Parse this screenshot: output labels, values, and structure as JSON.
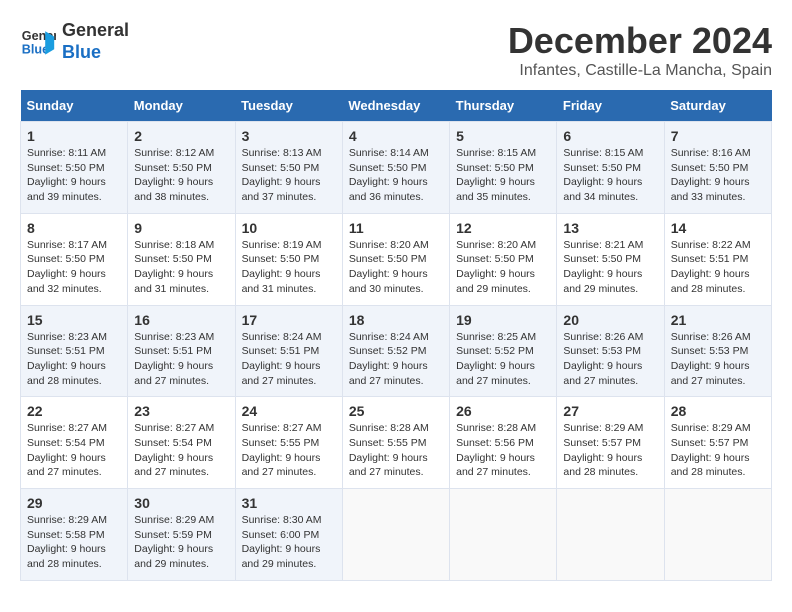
{
  "header": {
    "logo_line1": "General",
    "logo_line2": "Blue",
    "main_title": "December 2024",
    "subtitle": "Infantes, Castille-La Mancha, Spain"
  },
  "calendar": {
    "weekdays": [
      "Sunday",
      "Monday",
      "Tuesday",
      "Wednesday",
      "Thursday",
      "Friday",
      "Saturday"
    ],
    "weeks": [
      [
        {
          "day": "1",
          "info": "Sunrise: 8:11 AM\nSunset: 5:50 PM\nDaylight: 9 hours and 39 minutes."
        },
        {
          "day": "2",
          "info": "Sunrise: 8:12 AM\nSunset: 5:50 PM\nDaylight: 9 hours and 38 minutes."
        },
        {
          "day": "3",
          "info": "Sunrise: 8:13 AM\nSunset: 5:50 PM\nDaylight: 9 hours and 37 minutes."
        },
        {
          "day": "4",
          "info": "Sunrise: 8:14 AM\nSunset: 5:50 PM\nDaylight: 9 hours and 36 minutes."
        },
        {
          "day": "5",
          "info": "Sunrise: 8:15 AM\nSunset: 5:50 PM\nDaylight: 9 hours and 35 minutes."
        },
        {
          "day": "6",
          "info": "Sunrise: 8:15 AM\nSunset: 5:50 PM\nDaylight: 9 hours and 34 minutes."
        },
        {
          "day": "7",
          "info": "Sunrise: 8:16 AM\nSunset: 5:50 PM\nDaylight: 9 hours and 33 minutes."
        }
      ],
      [
        {
          "day": "8",
          "info": "Sunrise: 8:17 AM\nSunset: 5:50 PM\nDaylight: 9 hours and 32 minutes."
        },
        {
          "day": "9",
          "info": "Sunrise: 8:18 AM\nSunset: 5:50 PM\nDaylight: 9 hours and 31 minutes."
        },
        {
          "day": "10",
          "info": "Sunrise: 8:19 AM\nSunset: 5:50 PM\nDaylight: 9 hours and 31 minutes."
        },
        {
          "day": "11",
          "info": "Sunrise: 8:20 AM\nSunset: 5:50 PM\nDaylight: 9 hours and 30 minutes."
        },
        {
          "day": "12",
          "info": "Sunrise: 8:20 AM\nSunset: 5:50 PM\nDaylight: 9 hours and 29 minutes."
        },
        {
          "day": "13",
          "info": "Sunrise: 8:21 AM\nSunset: 5:50 PM\nDaylight: 9 hours and 29 minutes."
        },
        {
          "day": "14",
          "info": "Sunrise: 8:22 AM\nSunset: 5:51 PM\nDaylight: 9 hours and 28 minutes."
        }
      ],
      [
        {
          "day": "15",
          "info": "Sunrise: 8:23 AM\nSunset: 5:51 PM\nDaylight: 9 hours and 28 minutes."
        },
        {
          "day": "16",
          "info": "Sunrise: 8:23 AM\nSunset: 5:51 PM\nDaylight: 9 hours and 27 minutes."
        },
        {
          "day": "17",
          "info": "Sunrise: 8:24 AM\nSunset: 5:51 PM\nDaylight: 9 hours and 27 minutes."
        },
        {
          "day": "18",
          "info": "Sunrise: 8:24 AM\nSunset: 5:52 PM\nDaylight: 9 hours and 27 minutes."
        },
        {
          "day": "19",
          "info": "Sunrise: 8:25 AM\nSunset: 5:52 PM\nDaylight: 9 hours and 27 minutes."
        },
        {
          "day": "20",
          "info": "Sunrise: 8:26 AM\nSunset: 5:53 PM\nDaylight: 9 hours and 27 minutes."
        },
        {
          "day": "21",
          "info": "Sunrise: 8:26 AM\nSunset: 5:53 PM\nDaylight: 9 hours and 27 minutes."
        }
      ],
      [
        {
          "day": "22",
          "info": "Sunrise: 8:27 AM\nSunset: 5:54 PM\nDaylight: 9 hours and 27 minutes."
        },
        {
          "day": "23",
          "info": "Sunrise: 8:27 AM\nSunset: 5:54 PM\nDaylight: 9 hours and 27 minutes."
        },
        {
          "day": "24",
          "info": "Sunrise: 8:27 AM\nSunset: 5:55 PM\nDaylight: 9 hours and 27 minutes."
        },
        {
          "day": "25",
          "info": "Sunrise: 8:28 AM\nSunset: 5:55 PM\nDaylight: 9 hours and 27 minutes."
        },
        {
          "day": "26",
          "info": "Sunrise: 8:28 AM\nSunset: 5:56 PM\nDaylight: 9 hours and 27 minutes."
        },
        {
          "day": "27",
          "info": "Sunrise: 8:29 AM\nSunset: 5:57 PM\nDaylight: 9 hours and 28 minutes."
        },
        {
          "day": "28",
          "info": "Sunrise: 8:29 AM\nSunset: 5:57 PM\nDaylight: 9 hours and 28 minutes."
        }
      ],
      [
        {
          "day": "29",
          "info": "Sunrise: 8:29 AM\nSunset: 5:58 PM\nDaylight: 9 hours and 28 minutes."
        },
        {
          "day": "30",
          "info": "Sunrise: 8:29 AM\nSunset: 5:59 PM\nDaylight: 9 hours and 29 minutes."
        },
        {
          "day": "31",
          "info": "Sunrise: 8:30 AM\nSunset: 6:00 PM\nDaylight: 9 hours and 29 minutes."
        },
        null,
        null,
        null,
        null
      ]
    ]
  }
}
